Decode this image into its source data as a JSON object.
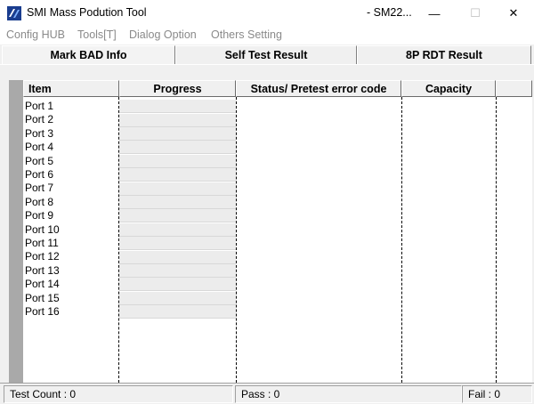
{
  "window": {
    "title": "SMI Mass Podution Tool",
    "title_suffix": "- SM22...",
    "buttons": {
      "minimize": "—",
      "maximize": "☐",
      "close": "✕"
    },
    "app_icon": "smi-app-icon"
  },
  "menu": {
    "items": [
      "Config HUB",
      "Tools[T]",
      "Dialog Option",
      "Others Setting"
    ]
  },
  "tabs": [
    "Mark BAD Info",
    "Self Test Result",
    "8P RDT Result"
  ],
  "table": {
    "columns": [
      "Item",
      "Progress",
      "Status/ Pretest error code",
      "Capacity"
    ],
    "rows": [
      "Port 1",
      "Port 2",
      "Port 3",
      "Port 4",
      "Port 5",
      "Port 6",
      "Port 7",
      "Port 8",
      "Port 9",
      "Port 10",
      "Port 11",
      "Port 12",
      "Port 13",
      "Port 14",
      "Port 15",
      "Port 16"
    ]
  },
  "statusbar": {
    "test_count": "Test Count : 0",
    "pass": "Pass : 0",
    "fail": "Fail : 0"
  }
}
